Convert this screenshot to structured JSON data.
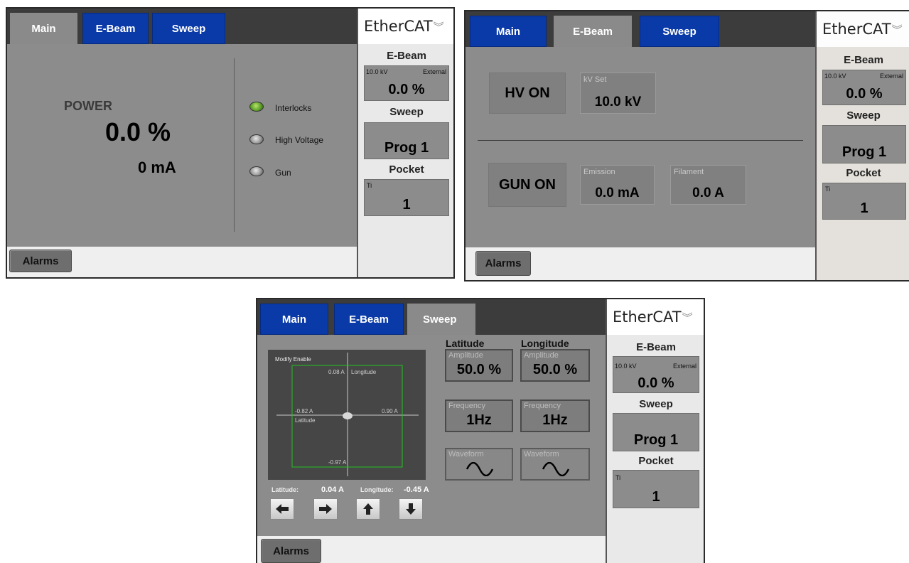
{
  "tabs": {
    "main": "Main",
    "ebeam": "E-Beam",
    "sweep": "Sweep"
  },
  "footer": {
    "alarms": "Alarms"
  },
  "sidebar": {
    "logo": "EtherCAT",
    "logo_icon": "chevron-double-down-icon",
    "ebeam_title": "E-Beam",
    "ebeam_kv": "10.0 kV",
    "ebeam_mode": "External",
    "ebeam_value": "0.0 %",
    "sweep_title": "Sweep",
    "sweep_value": "Prog 1",
    "pocket_title": "Pocket",
    "pocket_material": "Ti",
    "pocket_value": "1"
  },
  "main_screen": {
    "power_label": "POWER",
    "power_percent": "0.0 %",
    "power_current": "0 mA",
    "indicators": [
      {
        "label": "Interlocks",
        "state": "green"
      },
      {
        "label": "High Voltage",
        "state": "grey"
      },
      {
        "label": "Gun",
        "state": "grey"
      }
    ]
  },
  "ebeam_screen": {
    "hv_button": "HV ON",
    "kv_set_label": "kV Set",
    "kv_set_value": "10.0 kV",
    "gun_button": "GUN ON",
    "emission_label": "Emission",
    "emission_value": "0.0 mA",
    "filament_label": "Filament",
    "filament_value": "0.0 A"
  },
  "sweep_screen": {
    "plot": {
      "modify_enable": "Modify Enable",
      "top": "0.08 A",
      "longitude_axis": "Longitude",
      "left": "-0.82 A",
      "latitude_axis": "Latitude",
      "right": "0.90 A",
      "bottom": "-0.97 A"
    },
    "latitude_label": "Latitude:",
    "latitude_value": "0.04 A",
    "longitude_label": "Longitude:",
    "longitude_value": "-0.45 A",
    "latitude_title": "Latitude",
    "longitude_title": "Longitude",
    "amplitude_label": "Amplitude",
    "lat_amplitude": "50.0 %",
    "lon_amplitude": "50.0 %",
    "frequency_label": "Frequency",
    "lat_frequency": "1Hz",
    "lon_frequency": "1Hz",
    "waveform_label": "Waveform",
    "waveform_icon": "sine-wave-icon"
  },
  "colors": {
    "tab_blue": "#0a3aa8",
    "panel_grey": "#8c8c8c",
    "led_green": "#5fa02a",
    "plot_box": "#22c322"
  }
}
